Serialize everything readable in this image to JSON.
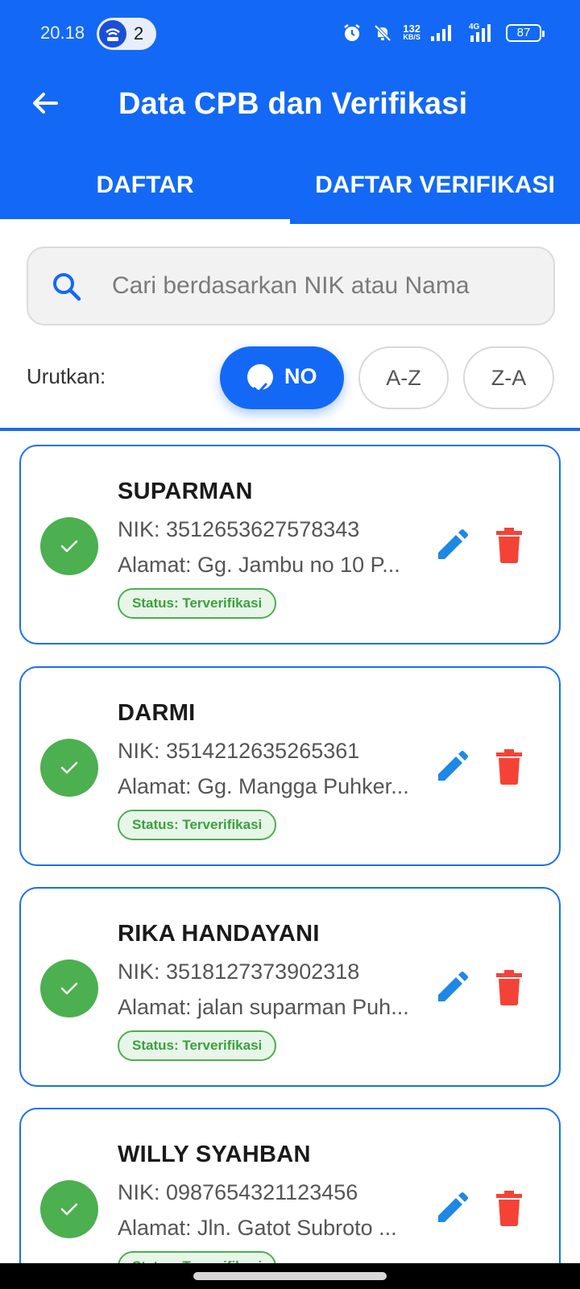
{
  "status_bar": {
    "time": "20.18",
    "notification_count": "2",
    "net_speed_top": "132",
    "net_speed_bottom": "KB/S",
    "network_type": "4G",
    "battery": "87"
  },
  "app_bar": {
    "title": "Data CPB dan Verifikasi"
  },
  "tabs": [
    {
      "label": "DAFTAR",
      "active": true
    },
    {
      "label": "DAFTAR VERIFIKASI",
      "active": false
    }
  ],
  "search": {
    "placeholder": "Cari berdasarkan NIK atau Nama",
    "value": ""
  },
  "sort": {
    "label": "Urutkan:",
    "options": [
      "NO",
      "A-Z",
      "Z-A"
    ],
    "selected": "NO"
  },
  "colors": {
    "primary": "#1369F5",
    "success": "#4caf50",
    "danger": "#f44336",
    "edit": "#1e88e5"
  },
  "records": [
    {
      "name": "SUPARMAN",
      "nik": "NIK: 3512653627578343",
      "address": "Alamat: Gg. Jambu no 10  P...",
      "status": "Status: Terverifikasi"
    },
    {
      "name": "DARMI",
      "nik": "NIK: 3514212635265361",
      "address": "Alamat: Gg. Mangga  Puhker...",
      "status": "Status: Terverifikasi"
    },
    {
      "name": "RIKA HANDAYANI",
      "nik": "NIK: 3518127373902318",
      "address": "Alamat: jalan suparman  Puh...",
      "status": "Status: Terverifikasi"
    },
    {
      "name": "WILLY SYAHBAN",
      "nik": "NIK: 0987654321123456",
      "address": "Alamat: Jln. Gatot Subroto  ...",
      "status": "Status: Terverifikasi"
    }
  ]
}
